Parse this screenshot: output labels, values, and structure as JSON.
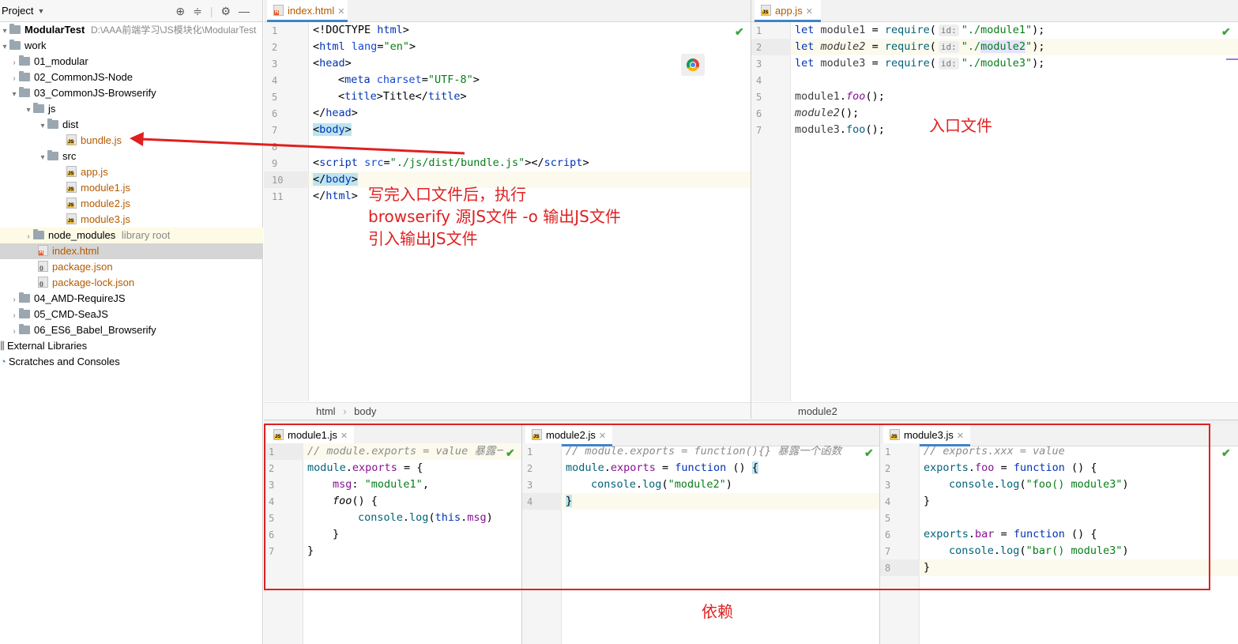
{
  "project": {
    "header_label": "Project",
    "tree": [
      {
        "label": "ModularTest",
        "path": "D:\\AAA前端学习\\JS模块化\\ModularTest",
        "kind": "root"
      },
      {
        "label": "work",
        "kind": "folder"
      },
      {
        "label": "01_modular",
        "kind": "folder"
      },
      {
        "label": "02_CommonJS-Node",
        "kind": "folder"
      },
      {
        "label": "03_CommonJS-Browserify",
        "kind": "folder"
      },
      {
        "label": "js",
        "kind": "folder"
      },
      {
        "label": "dist",
        "kind": "folder"
      },
      {
        "label": "bundle.js",
        "kind": "js"
      },
      {
        "label": "src",
        "kind": "folder"
      },
      {
        "label": "app.js",
        "kind": "js"
      },
      {
        "label": "module1.js",
        "kind": "js"
      },
      {
        "label": "module2.js",
        "kind": "js"
      },
      {
        "label": "module3.js",
        "kind": "js"
      },
      {
        "label": "node_modules",
        "suffix": "library root",
        "kind": "folder"
      },
      {
        "label": "index.html",
        "kind": "html"
      },
      {
        "label": "package.json",
        "kind": "json"
      },
      {
        "label": "package-lock.json",
        "kind": "json"
      },
      {
        "label": "04_AMD-RequireJS",
        "kind": "folder"
      },
      {
        "label": "05_CMD-SeaJS",
        "kind": "folder"
      },
      {
        "label": "06_ES6_Babel_Browserify",
        "kind": "folder"
      },
      {
        "label": "External Libraries",
        "kind": "lib"
      },
      {
        "label": "Scratches and Consoles",
        "kind": "scratch"
      }
    ]
  },
  "editors": {
    "index_html": {
      "tab": "index.html",
      "breadcrumb": [
        "html",
        "body"
      ],
      "line_numbers": [
        "1",
        "2",
        "3",
        "4",
        "5",
        "6",
        "7",
        "8",
        "9",
        "10",
        "11"
      ]
    },
    "app_js": {
      "tab": "app.js",
      "breadcrumb": "module2",
      "line_numbers": [
        "1",
        "2",
        "3",
        "4",
        "5",
        "6",
        "7"
      ],
      "param_hint": "id:"
    },
    "module1_js": {
      "tab": "module1.js",
      "line_numbers": [
        "1",
        "2",
        "3",
        "4",
        "5",
        "6",
        "7"
      ]
    },
    "module2_js": {
      "tab": "module2.js",
      "line_numbers": [
        "1",
        "2",
        "3",
        "4"
      ]
    },
    "module3_js": {
      "tab": "module3.js",
      "line_numbers": [
        "1",
        "2",
        "3",
        "4",
        "5",
        "6",
        "7",
        "8"
      ]
    }
  },
  "annotations": {
    "entry_file": "入口文件",
    "instruction_line1": "写完入口文件后，执行",
    "instruction_line2": "browserify 源JS文件 -o 输出JS文件",
    "instruction_line3": "引入输出JS文件",
    "dependencies": "依赖"
  },
  "colors": {
    "annotation_red": "#e02020",
    "accent_blue": "#4083c9"
  }
}
